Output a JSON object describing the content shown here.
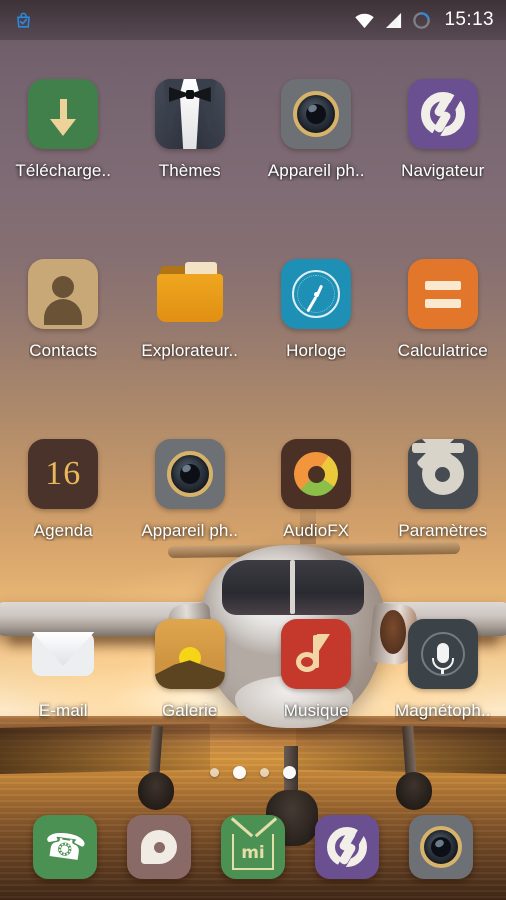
{
  "status_bar": {
    "time": "15:13",
    "notification_icon": "shopping-bag-icon",
    "notification_color": "#2a8ae0",
    "icons": [
      "wifi-icon",
      "signal-icon",
      "circle-sync-icon"
    ]
  },
  "home_screen": {
    "apps": [
      {
        "label": "Télécharge..",
        "icon": "download-icon",
        "bg": "#41804a"
      },
      {
        "label": "Thèmes",
        "icon": "tuxedo-icon",
        "bg": "#2d313c"
      },
      {
        "label": "Appareil ph..",
        "icon": "camera-icon",
        "bg": "#6d7074"
      },
      {
        "label": "Navigateur",
        "icon": "browser-swirl-icon",
        "bg": "#6a5090"
      },
      {
        "label": "Contacts",
        "icon": "contacts-person-icon",
        "bg": "#c9a877"
      },
      {
        "label": "Explorateur..",
        "icon": "folder-icon",
        "bg": "#efa61f"
      },
      {
        "label": "Horloge",
        "icon": "clock-icon",
        "bg": "#1e8fb5"
      },
      {
        "label": "Calculatrice",
        "icon": "equals-icon",
        "bg": "#e2762b"
      },
      {
        "label": "Agenda",
        "icon": "calendar-16-icon",
        "bg": "#4a332a",
        "day": "16"
      },
      {
        "label": "Appareil ph..",
        "icon": "camera-icon",
        "bg": "#6d7074"
      },
      {
        "label": "AudioFX",
        "icon": "audio-donut-icon",
        "bg": "#4a3025"
      },
      {
        "label": "Paramètres",
        "icon": "gear-icon",
        "bg": "#474c52"
      },
      {
        "label": "E-mail",
        "icon": "envelope-icon",
        "bg": "#eceef0"
      },
      {
        "label": "Galerie",
        "icon": "landscape-icon",
        "bg": "#cf9440"
      },
      {
        "label": "Musique",
        "icon": "music-note-icon",
        "bg": "#c4392c"
      },
      {
        "label": "Magnétoph..",
        "icon": "microphone-icon",
        "bg": "#3b4348"
      }
    ],
    "page_dots": {
      "count": 4,
      "active_index": 1
    }
  },
  "dock": {
    "items": [
      {
        "name": "Téléphone",
        "icon": "phone-handset-icon",
        "bg": "#4c9154"
      },
      {
        "name": "Messages",
        "icon": "message-bubble-icon",
        "bg": "#8a6a67"
      },
      {
        "name": "Mi Store",
        "icon": "mi-house-icon",
        "bg": "#4c9154",
        "text": "mi"
      },
      {
        "name": "Navigateur",
        "icon": "browser-swirl-icon",
        "bg": "#6a5090"
      },
      {
        "name": "Appareil photo",
        "icon": "camera-icon",
        "bg": "#6d7074"
      }
    ]
  },
  "wallpaper": {
    "description": "private jet on runway at sunset"
  }
}
